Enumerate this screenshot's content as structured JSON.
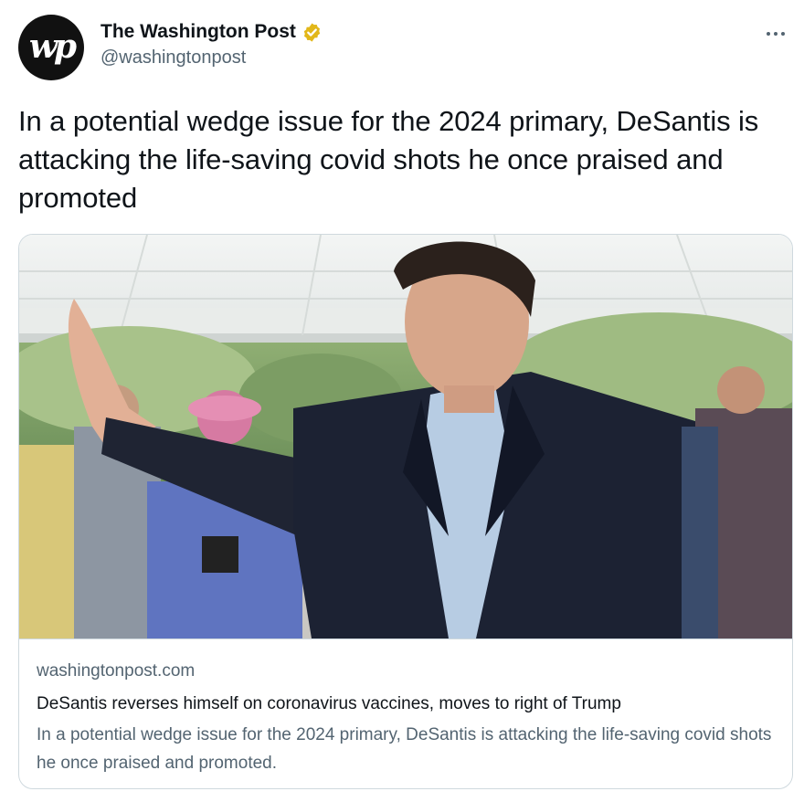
{
  "author": {
    "display_name": "The Washington Post",
    "handle": "@washingtonpost",
    "avatar_text": "wp",
    "verified_icon": "verified-badge-gold",
    "verified_color": "#e2b719"
  },
  "menu": {
    "icon": "more-horizontal-icon"
  },
  "tweet": {
    "text": "In a potential wedge issue for the 2024 primary, DeSantis is attacking the life-saving covid shots he once praised and promoted"
  },
  "card": {
    "image_alt_icon": "news-photo",
    "domain": "washingtonpost.com",
    "title": "DeSantis reverses himself on coronavirus vaccines, moves to right of Trump",
    "description": "In a potential wedge issue for the 2024 primary, DeSantis is attacking the life-saving covid shots he once praised and promoted."
  },
  "colors": {
    "text_primary": "#0f1419",
    "text_secondary": "#536471",
    "border": "#cfd9de"
  }
}
